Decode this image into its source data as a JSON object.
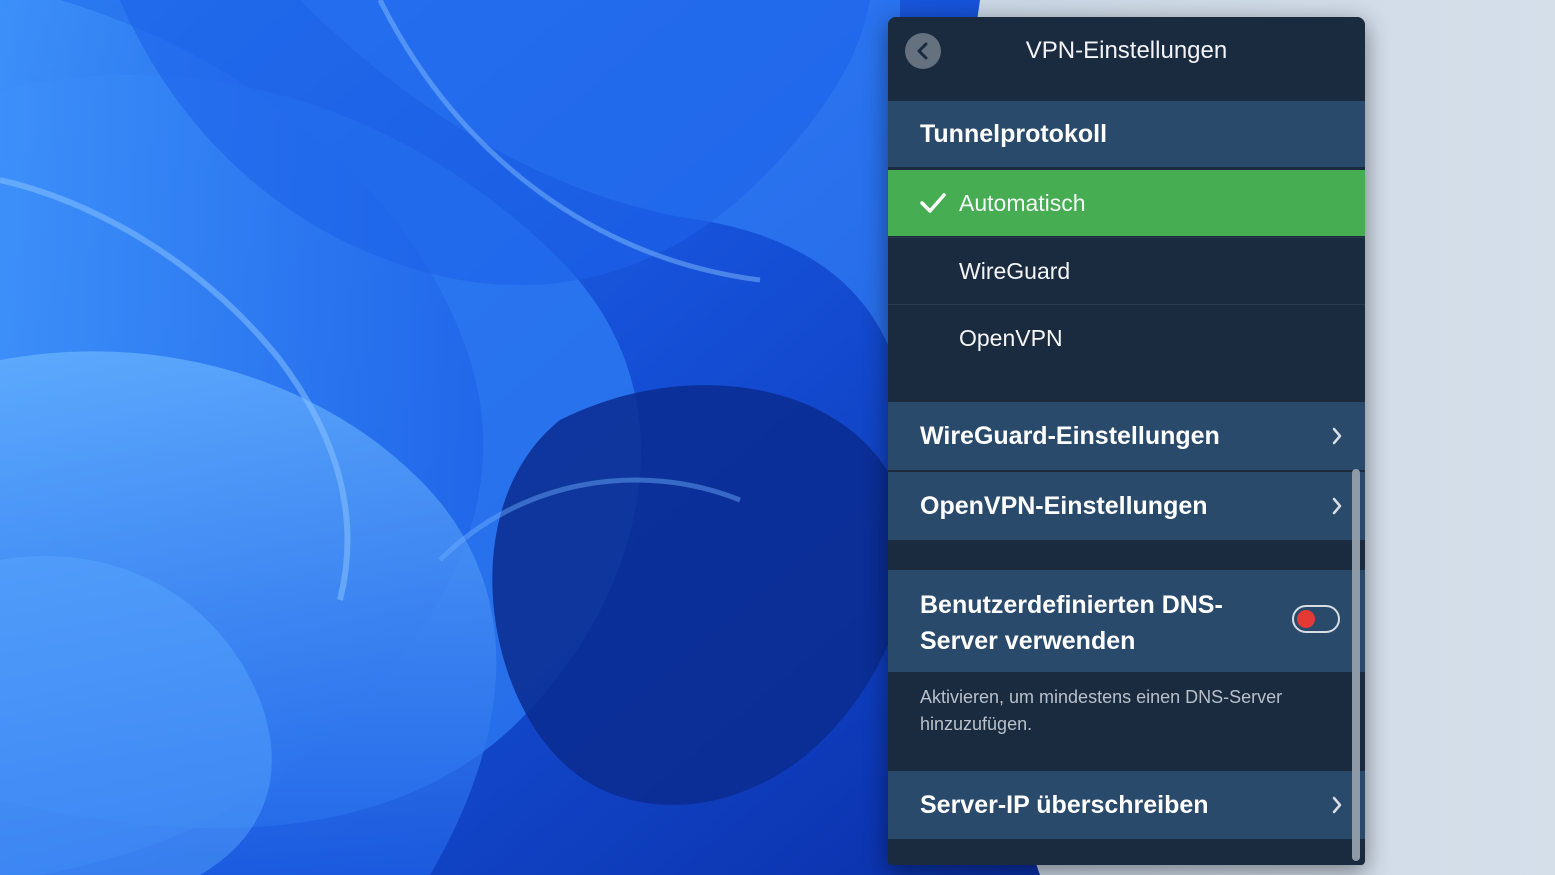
{
  "window": {
    "title": "VPN-Einstellungen"
  },
  "icons": {
    "back": "chevron-left-icon",
    "check": "checkmark-icon",
    "chevron": "chevron-right-icon"
  },
  "tunnel": {
    "heading": "Tunnelprotokoll",
    "options": [
      {
        "label": "Automatisch",
        "selected": true
      },
      {
        "label": "WireGuard",
        "selected": false
      },
      {
        "label": "OpenVPN",
        "selected": false
      }
    ]
  },
  "settings": {
    "wireguard_label": "WireGuard-Einstellungen",
    "openvpn_label": "OpenVPN-Einstellungen"
  },
  "dns": {
    "label": "Benutzerdefinierten DNS-Server verwenden",
    "enabled": false,
    "hint": "Aktivieren, um mindestens einen DNS-Server hinzuzufügen."
  },
  "server_ip": {
    "label": "Server-IP überschreiben"
  },
  "colors": {
    "panel_bg": "#1b2b3f",
    "section_bg": "#2a4a6c",
    "selected_bg": "#47ad52",
    "toggle_knob": "#e53935",
    "wallpaper_blue": "#1f5fe6"
  }
}
